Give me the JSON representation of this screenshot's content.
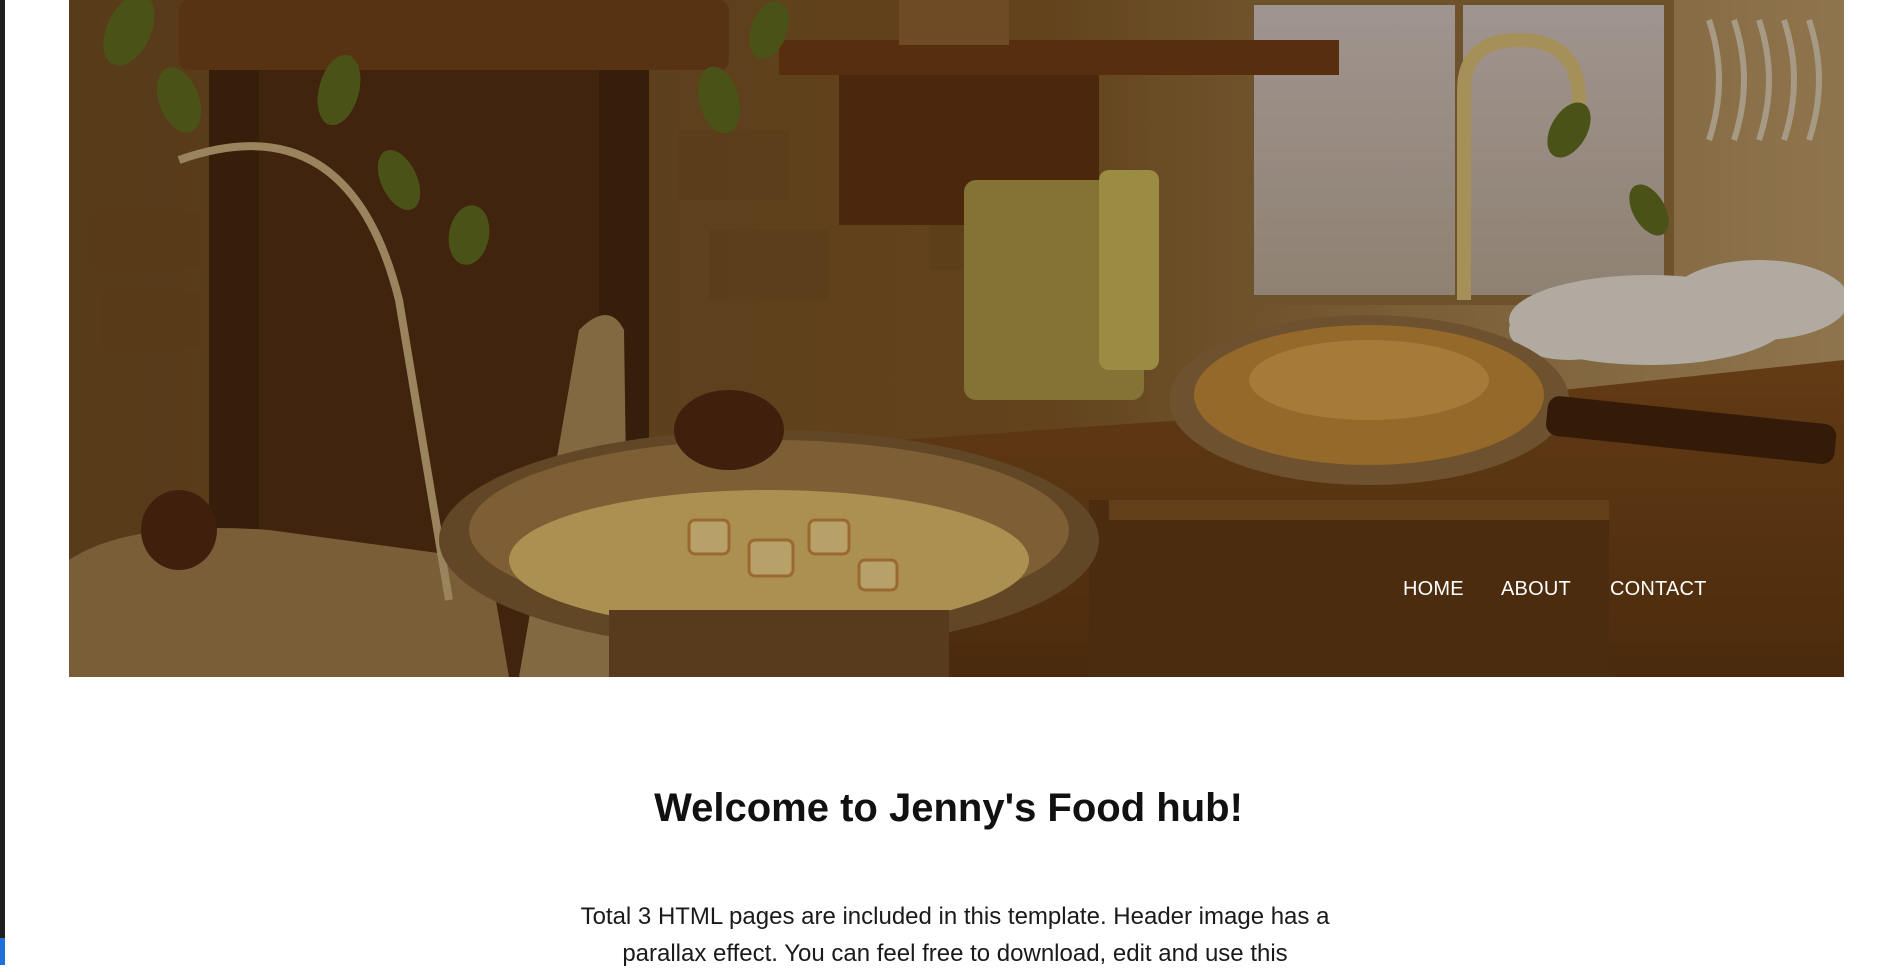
{
  "left_edge": {
    "accent_color": "#1e6fd9"
  },
  "hero": {
    "image_description_icon": "kitchen-illustration",
    "nav": {
      "home": "HOME",
      "about": "ABOUT",
      "contact": "CONTACT"
    }
  },
  "main": {
    "heading": "Welcome to Jenny's Food hub!",
    "intro_line_1": "Total 3 HTML pages are included in this template. Header image has a",
    "intro_line_2": "parallax effect. You can feel free to download, edit and use this"
  }
}
